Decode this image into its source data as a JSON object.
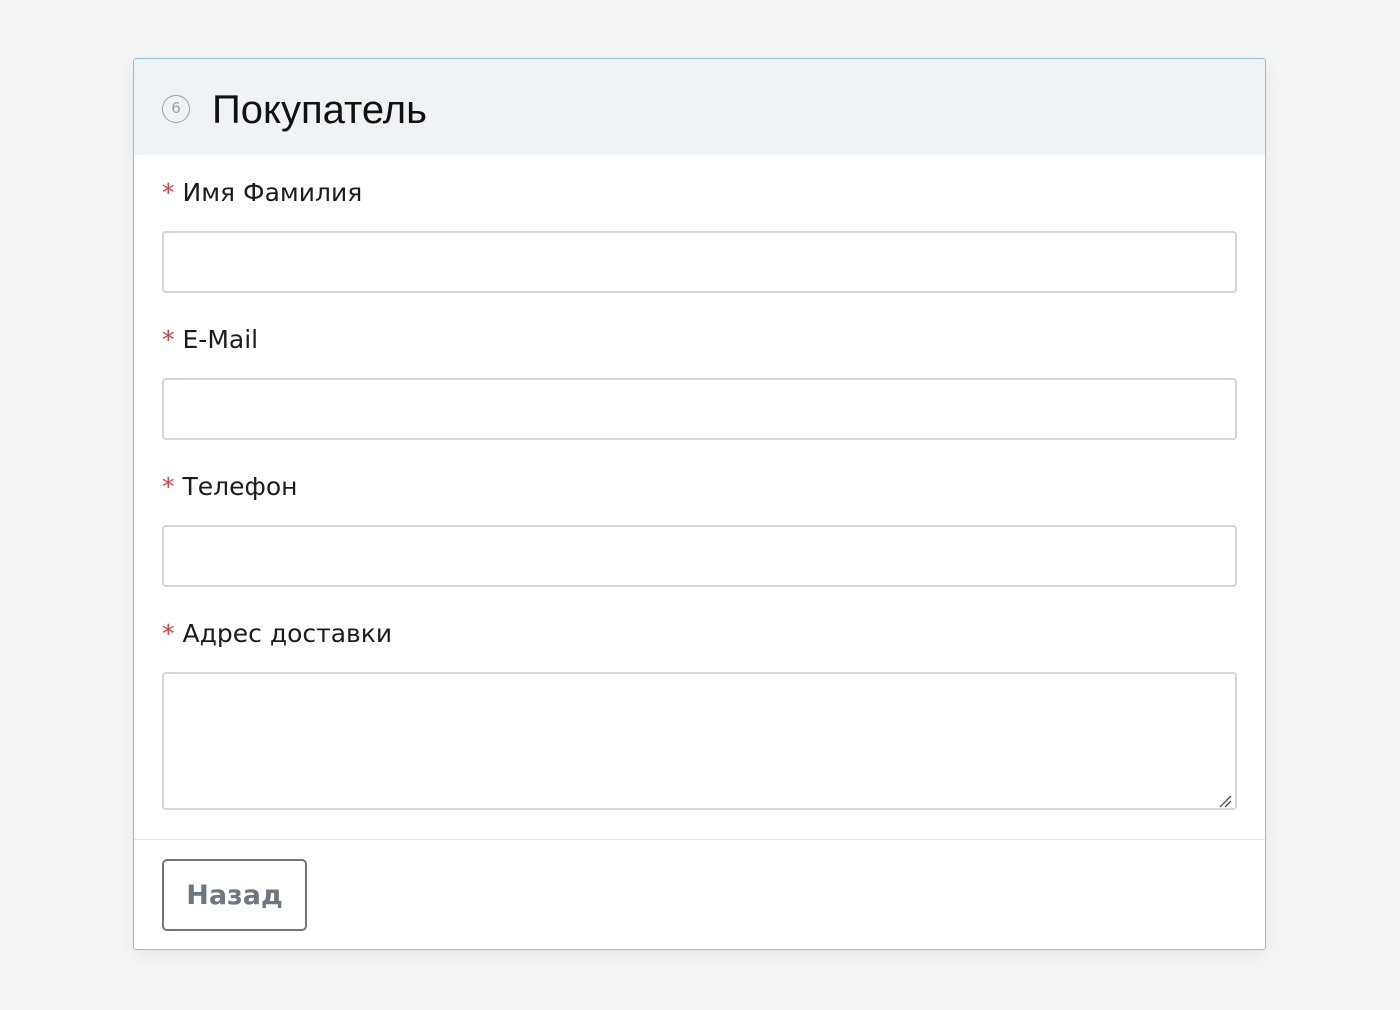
{
  "card": {
    "step_number": "6",
    "title": "Покупатель"
  },
  "form": {
    "required_marker": "*",
    "fields": [
      {
        "label": "Имя Фамилия",
        "value": "",
        "type": "text"
      },
      {
        "label": "E-Mail",
        "value": "",
        "type": "email"
      },
      {
        "label": "Телефон",
        "value": "",
        "type": "tel"
      },
      {
        "label": "Адрес доставки",
        "value": "",
        "type": "textarea"
      }
    ]
  },
  "footer": {
    "back_label": "Назад"
  },
  "colors": {
    "page_background": "#f4f5f7",
    "header_background": "#f0f3f6",
    "card_border": "#86c6d8",
    "required_marker": "#e03a3a",
    "button_text": "#6e7781"
  },
  "icons": {
    "step_badge": "circled-number-icon",
    "textarea_resize": "resize-handle-icon"
  }
}
